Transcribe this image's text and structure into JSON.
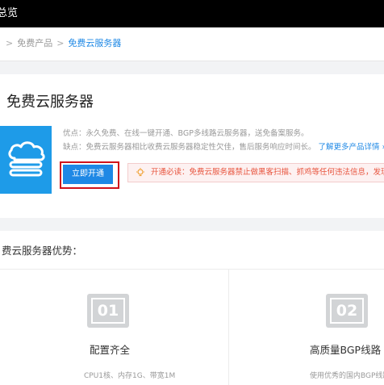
{
  "topbar": {
    "title": "总览"
  },
  "breadcrumb": {
    "items": [
      " ",
      "免费产品",
      "免费云服务器"
    ]
  },
  "product": {
    "title": "免费云服务器",
    "advantages": "优点：永久免费、在线一键开通、BGP多线路云服务器，送免备案服务。",
    "disadvantages": "缺点：免费云服务器相比收费云服务器稳定性欠佳，售后服务响应时间长。",
    "more_link": "了解更多产品详情 ›",
    "open_button": "立即开通",
    "notice": "开通必读：免费云服务器禁止做黑客扫描、抓鸡等任何违法信息，发现",
    "brand_color": "#1e9be8",
    "highlight_color": "#d0121b",
    "logo_icon": "cloud-server-icon",
    "notice_icon": "lightbulb-icon"
  },
  "advantages": {
    "heading": "费云服务器优势：",
    "features": [
      {
        "num": "01",
        "title": "配置齐全",
        "desc": "CPU1核、内存1G、带宽1M"
      },
      {
        "num": "02",
        "title": "高质量BGP线路",
        "desc": "使用优秀的国内BGP线路"
      }
    ]
  }
}
